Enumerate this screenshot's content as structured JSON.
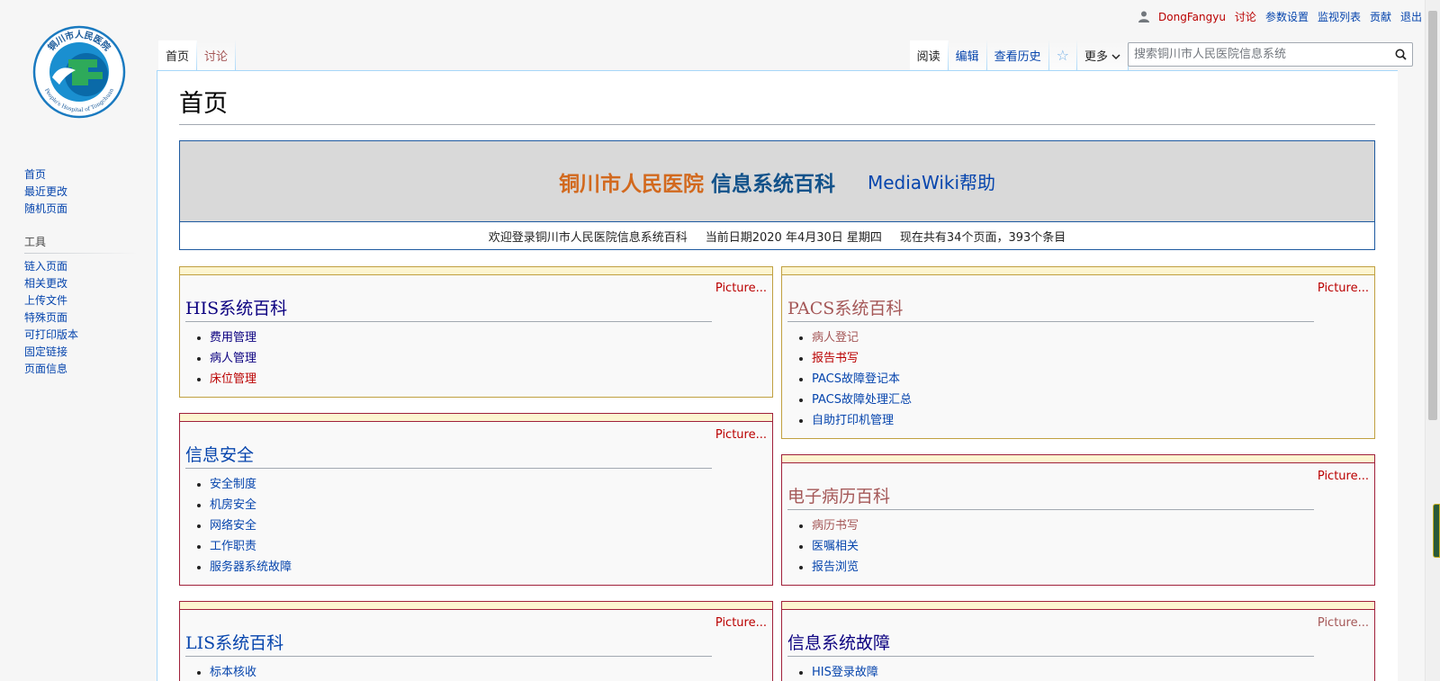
{
  "personal": {
    "username": "DongFangyu",
    "talk": "讨论",
    "preferences": "参数设置",
    "watchlist": "监视列表",
    "contributions": "贡献",
    "logout": "退出"
  },
  "logo": {
    "top_text": "铜川市人民医院",
    "bottom_text": "People's Hospital of Tongchuan"
  },
  "sidebar": {
    "nav": [
      {
        "label": "首页"
      },
      {
        "label": "最近更改"
      },
      {
        "label": "随机页面"
      }
    ],
    "tools_heading": "工具",
    "tools": [
      {
        "label": "链入页面"
      },
      {
        "label": "相关更改"
      },
      {
        "label": "上传文件"
      },
      {
        "label": "特殊页面"
      },
      {
        "label": "可打印版本"
      },
      {
        "label": "固定链接"
      },
      {
        "label": "页面信息"
      }
    ]
  },
  "tabs": {
    "left": [
      {
        "label": "首页"
      },
      {
        "label": "讨论"
      }
    ],
    "read": "阅读",
    "edit": "编辑",
    "history": "查看历史",
    "more": "更多"
  },
  "search": {
    "placeholder": "搜索铜川市人民医院信息系统"
  },
  "page": {
    "title": "首页"
  },
  "banner": {
    "title_orange": "铜川市人民医院",
    "title_blue": "信息系统百科",
    "help": "MediaWiki帮助",
    "welcome": "欢迎登录铜川市人民医院信息系统百科",
    "date": "当前日期2020 年4月30日 星期四",
    "stats": "现在共有34个页面，393个条目"
  },
  "boxes": {
    "his": {
      "picture": "Picture...",
      "title": "HIS系统百科",
      "items": [
        "费用管理",
        "病人管理",
        "床位管理"
      ]
    },
    "security": {
      "picture": "Picture...",
      "title": "信息安全",
      "items": [
        "安全制度",
        "机房安全",
        "网络安全",
        "工作职责",
        "服务器系统故障"
      ]
    },
    "lis": {
      "picture": "Picture...",
      "title": "LIS系统百科",
      "items": [
        "标本核收"
      ]
    },
    "pacs": {
      "picture": "Picture...",
      "title": "PACS系统百科",
      "items": [
        "病人登记",
        "报告书写",
        "PACS故障登记本",
        "PACS故障处理汇总",
        "自助打印机管理"
      ]
    },
    "emr": {
      "picture": "Picture...",
      "title": "电子病历百科",
      "items": [
        "病历书写",
        "医嘱相关",
        "报告浏览"
      ]
    },
    "faults": {
      "picture": "Picture...",
      "title": "信息系统故障",
      "items": [
        "HIS登录故障"
      ]
    }
  }
}
